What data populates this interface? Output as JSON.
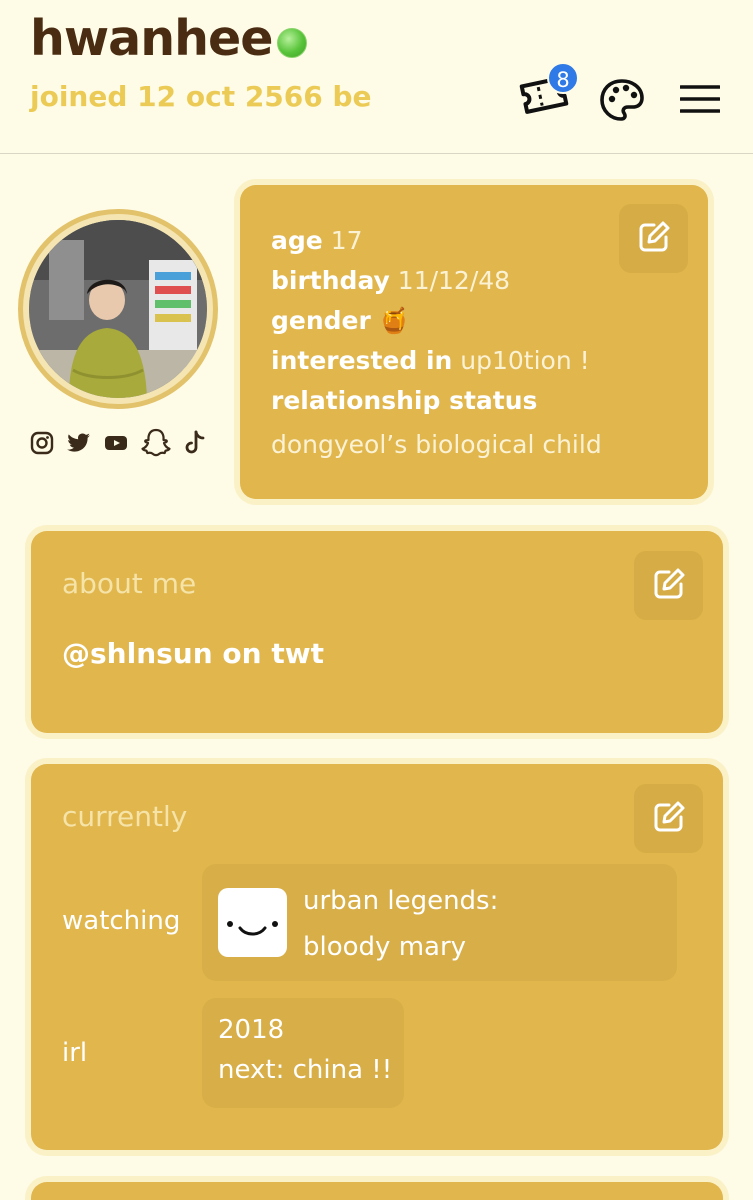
{
  "header": {
    "username": "hwanhee",
    "joined": "joined 12 oct 2566 be",
    "ticket_badge_count": "8",
    "online_status_color": "#58c43a"
  },
  "icons": {
    "ticket": "ticket-icon",
    "palette": "palette-icon",
    "menu": "hamburger-menu-icon",
    "edit": "edit-icon",
    "socials": [
      "instagram-icon",
      "twitter-icon",
      "youtube-icon",
      "snapchat-icon",
      "tiktok-icon"
    ]
  },
  "profile": {
    "age_key": "age",
    "age_val": "17",
    "birthday_key": "birthday",
    "birthday_val": "11/12/48",
    "gender_key": "gender",
    "gender_val": "🍯",
    "interested_key": "interested in",
    "interested_val": "up10tion !",
    "relationship_key": "relationship status",
    "relationship_val": "dongyeol’s biological child"
  },
  "about": {
    "title": "about me",
    "text": "@shlnsun on twt"
  },
  "currently": {
    "title": "currently",
    "watching_label": "watching",
    "watching_line1": "urban legends:",
    "watching_line2": "bloody mary",
    "irl_label": "irl",
    "irl_line1": "2018",
    "irl_line2": "next: china !!"
  },
  "colors": {
    "background": "#fefbe6",
    "card": "#e0b64d",
    "username": "#4a2c12",
    "joined": "#ebcb55",
    "badge": "#2f7ae6"
  }
}
